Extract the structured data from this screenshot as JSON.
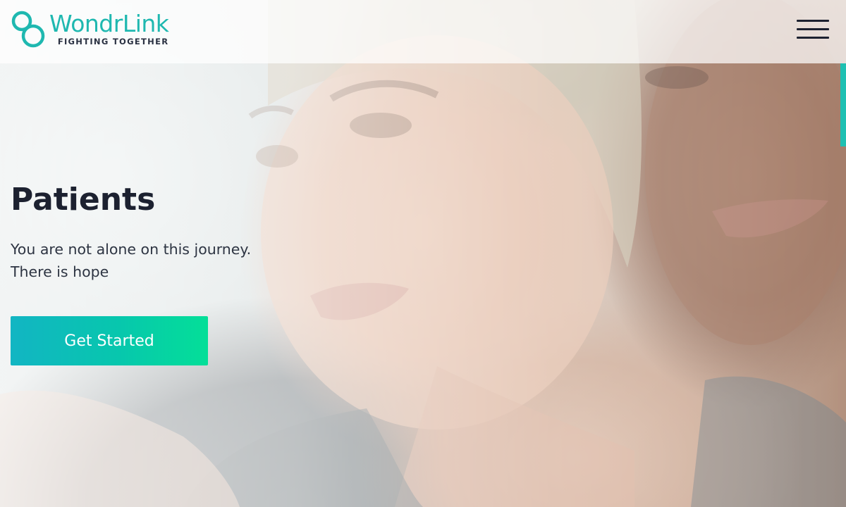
{
  "header": {
    "logo_name": "WondrLink",
    "logo_tagline": "FIGHTING TOGETHER",
    "menu_icon": "hamburger-menu-icon"
  },
  "hero": {
    "title": "Patients",
    "subtitle_lines": [
      "You are not alone on this journey.",
      "There is hope"
    ],
    "cta_label": "Get Started",
    "background_image": "photo-two-women-embracing"
  },
  "colors": {
    "brand_teal": "#1fb8b0",
    "dark_text": "#1c2130",
    "cta_gradient_start": "#12b5c3",
    "cta_gradient_end": "#04df98",
    "scroll_accent": "#1fc0b2"
  }
}
